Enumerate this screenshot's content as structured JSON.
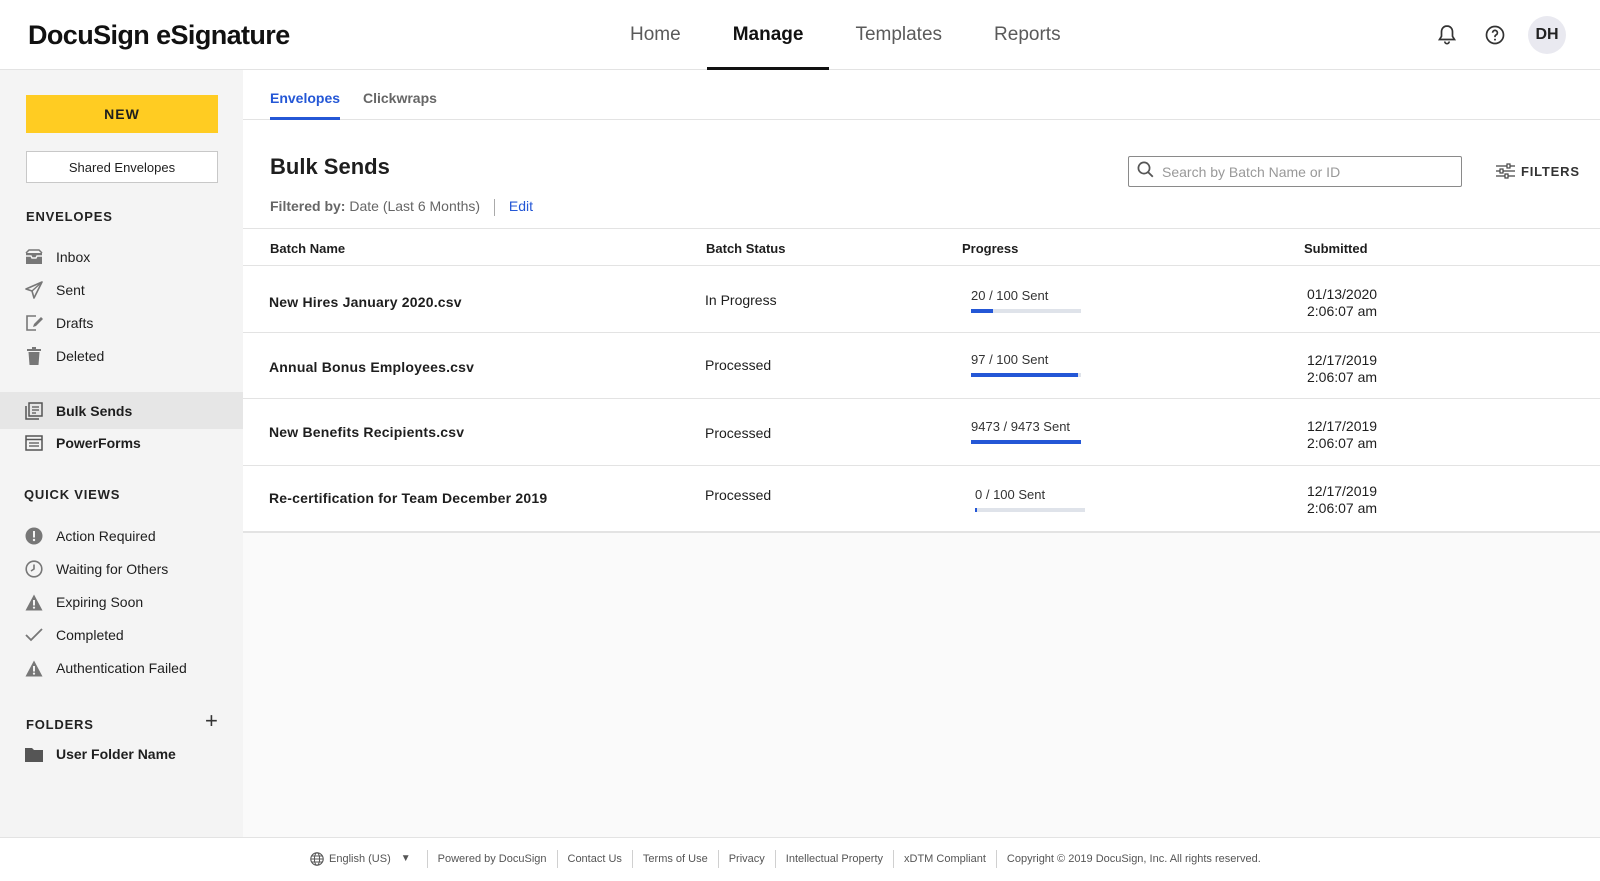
{
  "header": {
    "logo": "DocuSign eSignature",
    "nav": [
      "Home",
      "Manage",
      "Templates",
      "Reports"
    ],
    "active_nav": "Manage",
    "avatar_initials": "DH"
  },
  "sidebar": {
    "new_label": "NEW",
    "shared_label": "Shared Envelopes",
    "envelopes_heading": "ENVELOPES",
    "envelope_items": [
      {
        "label": "Inbox",
        "icon": "inbox-icon"
      },
      {
        "label": "Sent",
        "icon": "send-icon"
      },
      {
        "label": "Drafts",
        "icon": "draft-icon"
      },
      {
        "label": "Deleted",
        "icon": "trash-icon"
      }
    ],
    "tool_items": [
      {
        "label": "Bulk Sends",
        "icon": "bulk-send-icon",
        "active": true
      },
      {
        "label": "PowerForms",
        "icon": "powerform-icon",
        "active": false
      }
    ],
    "quick_views_heading": "QUICK VIEWS",
    "quick_views": [
      {
        "label": "Action Required",
        "icon": "alert-circle-icon"
      },
      {
        "label": "Waiting for Others",
        "icon": "clock-icon"
      },
      {
        "label": "Expiring Soon",
        "icon": "warning-icon"
      },
      {
        "label": "Completed",
        "icon": "check-icon"
      },
      {
        "label": "Authentication Failed",
        "icon": "warning-icon"
      }
    ],
    "folders_heading": "FOLDERS",
    "folders": [
      {
        "label": "User Folder Name",
        "icon": "folder-icon"
      }
    ]
  },
  "main": {
    "tabs": [
      "Envelopes",
      "Clickwraps"
    ],
    "active_tab": "Envelopes",
    "title": "Bulk Sends",
    "filter_label": "Filtered by:",
    "filter_value": "Date (Last 6 Months)",
    "edit_label": "Edit",
    "search_placeholder": "Search by Batch Name or ID",
    "filters_label": "FILTERS",
    "columns": [
      "Batch Name",
      "Batch Status",
      "Progress",
      "Submitted"
    ],
    "rows": [
      {
        "name": "New Hires January 2020.csv",
        "status": "In Progress",
        "progress_text": "20 / 100 Sent",
        "progress": 0.2,
        "date": "01/13/2020",
        "time": "2:06:07 am"
      },
      {
        "name": "Annual Bonus Employees.csv",
        "status": "Processed",
        "progress_text": "97 / 100 Sent",
        "progress": 0.97,
        "date": "12/17/2019",
        "time": "2:06:07 am"
      },
      {
        "name": "New Benefits Recipients.csv",
        "status": "Processed",
        "progress_text": "9473 / 9473 Sent",
        "progress": 1.0,
        "date": "12/17/2019",
        "time": "2:06:07 am"
      },
      {
        "name": "Re-certification for Team December 2019",
        "status": "Processed",
        "progress_text": "0 / 100 Sent",
        "progress": 0.0,
        "date": "12/17/2019",
        "time": "2:06:07 am"
      }
    ]
  },
  "footer": {
    "language": "English (US)",
    "links": [
      "Powered by DocuSign",
      "Contact Us",
      "Terms of Use",
      "Privacy",
      "Intellectual Property",
      "xDTM Compliant"
    ],
    "copyright": "Copyright © 2019 DocuSign, Inc. All rights reserved."
  },
  "colors": {
    "accent": "#2457d6",
    "new_button": "#ffcc22"
  }
}
